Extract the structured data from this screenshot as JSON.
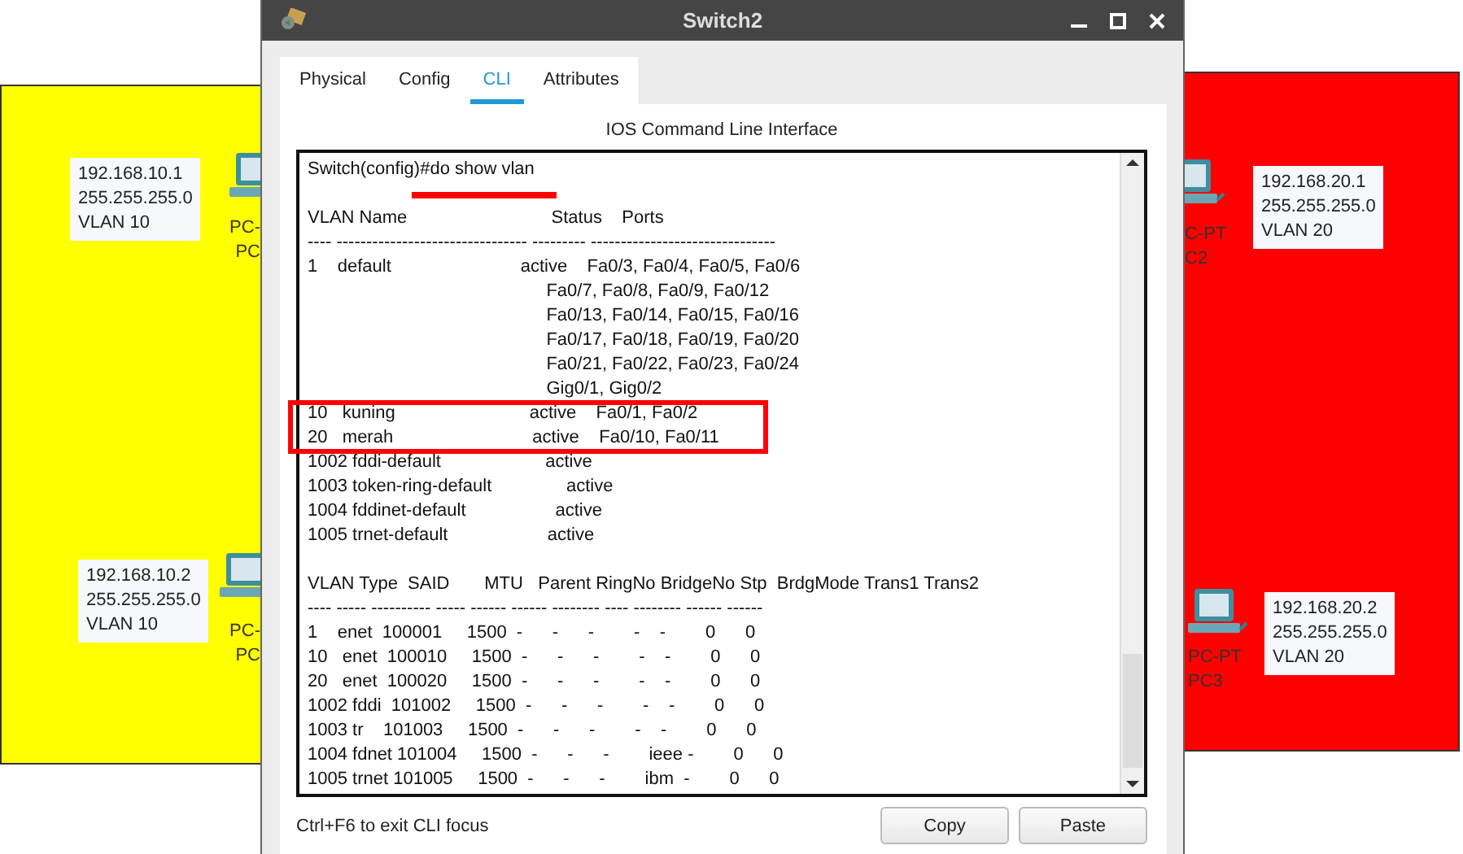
{
  "workspace": {
    "zones": [
      {
        "kind": "left",
        "color": "#ffff00",
        "hosts": [
          {
            "ip": "192.168.10.1",
            "mask": "255.255.255.0",
            "vlan": "VLAN 10",
            "model": "PC-",
            "name": "PC"
          },
          {
            "ip": "192.168.10.2",
            "mask": "255.255.255.0",
            "vlan": "VLAN 10",
            "model": "PC-",
            "name": "PC"
          }
        ]
      },
      {
        "kind": "right",
        "color": "#ff0000",
        "hosts": [
          {
            "ip": "192.168.20.1",
            "mask": "255.255.255.0",
            "vlan": "VLAN 20",
            "model": "C-PT",
            "name": "C2"
          },
          {
            "ip": "192.168.20.2",
            "mask": "255.255.255.0",
            "vlan": "VLAN 20",
            "model": "PC-PT",
            "name": "PC3"
          }
        ]
      }
    ]
  },
  "window": {
    "title": "Switch2",
    "tabs": [
      {
        "label": "Physical",
        "selected": false
      },
      {
        "label": "Config",
        "selected": false
      },
      {
        "label": "CLI",
        "selected": true
      },
      {
        "label": "Attributes",
        "selected": false
      }
    ],
    "heading": "IOS Command Line Interface",
    "terminal": {
      "blocks": [
        [
          "Switch(config)#do show vlan"
        ],
        [
          "VLAN Name                             Status    Ports",
          "---- -------------------------------- --------- -------------------------------",
          "1    default                          active    Fa0/3, Fa0/4, Fa0/5, Fa0/6",
          "                                                Fa0/7, Fa0/8, Fa0/9, Fa0/12",
          "                                                Fa0/13, Fa0/14, Fa0/15, Fa0/16",
          "                                                Fa0/17, Fa0/18, Fa0/19, Fa0/20",
          "                                                Fa0/21, Fa0/22, Fa0/23, Fa0/24",
          "                                                Gig0/1, Gig0/2",
          "10   kuning                           active    Fa0/1, Fa0/2",
          "20   merah                            active    Fa0/10, Fa0/11",
          "1002 fddi-default                     active",
          "1003 token-ring-default               active",
          "1004 fddinet-default                  active",
          "1005 trnet-default                    active"
        ],
        [
          "VLAN Type  SAID       MTU   Parent RingNo BridgeNo Stp  BrdgMode Trans1 Trans2",
          "---- ----- ---------- ----- ------ ------ -------- ---- -------- ------ ------",
          "1    enet  100001     1500  -      -      -        -    -        0      0",
          "10   enet  100010     1500  -      -      -        -    -        0      0",
          "20   enet  100020     1500  -      -      -        -    -        0      0",
          "1002 fddi  101002     1500  -      -      -        -    -        0      0",
          "1003 tr    101003     1500  -      -      -        -    -        0      0",
          "1004 fdnet 101004     1500  -      -      -        ieee -        0      0",
          "1005 trnet 101005     1500  -      -      -        ibm  -        0      0"
        ]
      ]
    },
    "hint": "Ctrl+F6 to exit CLI focus",
    "buttons": [
      "Copy",
      "Paste"
    ]
  }
}
